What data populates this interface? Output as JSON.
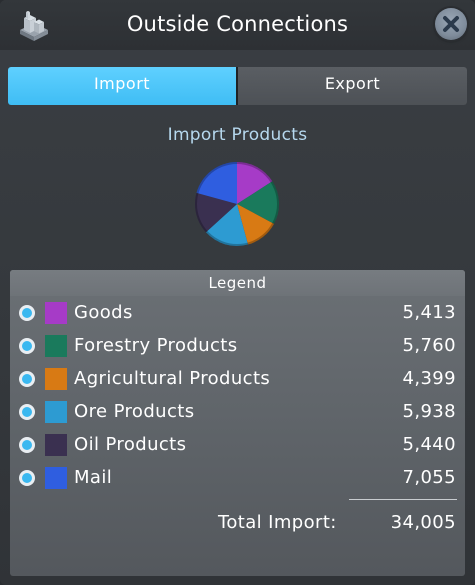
{
  "window": {
    "title": "Outside Connections",
    "icon": "buildings-icon",
    "close_icon": "close-icon"
  },
  "tabs": [
    {
      "label": "Import",
      "active": true
    },
    {
      "label": "Export",
      "active": false
    }
  ],
  "section_title": "Import Products",
  "legend": {
    "header": "Legend",
    "items": [
      {
        "label": "Goods",
        "value": "5,413",
        "color": "#a63bc7"
      },
      {
        "label": "Forestry Products",
        "value": "5,760",
        "color": "#1a7a5c"
      },
      {
        "label": "Agricultural Products",
        "value": "4,399",
        "color": "#d87a14"
      },
      {
        "label": "Ore Products",
        "value": "5,938",
        "color": "#2d9bd2"
      },
      {
        "label": "Oil Products",
        "value": "5,440",
        "color": "#3a3050"
      },
      {
        "label": "Mail",
        "value": "7,055",
        "color": "#2f5ee0"
      }
    ],
    "total_label": "Total Import:",
    "total_value": "34,005"
  },
  "chart_data": {
    "type": "pie",
    "categories": [
      "Goods",
      "Forestry Products",
      "Agricultural Products",
      "Ore Products",
      "Oil Products",
      "Mail"
    ],
    "values": [
      5413,
      5760,
      4399,
      5938,
      5440,
      7055
    ],
    "colors": [
      "#a63bc7",
      "#1a7a5c",
      "#d87a14",
      "#2d9bd2",
      "#3a3050",
      "#2f5ee0"
    ],
    "title": "Import Products"
  },
  "colors": {
    "accent": "#3fbdf4",
    "title_text": "#b6d8ee"
  }
}
